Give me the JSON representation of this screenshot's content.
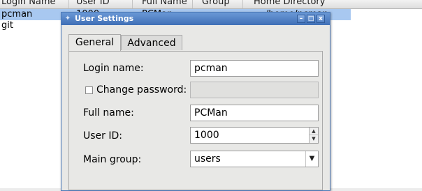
{
  "list": {
    "columns": [
      "Login Name",
      "User ID",
      "Full Name",
      "Group",
      "Home Directory"
    ],
    "rows": [
      {
        "login": "pcman",
        "uid": "1000",
        "fullname": "PCMan",
        "home_tail": "/home/pcman"
      },
      {
        "login": "git",
        "uid": "",
        "fullname": "",
        "home_tail": ""
      }
    ]
  },
  "dialog": {
    "title": "User Settings",
    "titlebar_buttons": {
      "minimize": "–",
      "maximize": "□",
      "close": "x"
    },
    "tabs": [
      {
        "label": "General",
        "active": true
      },
      {
        "label": "Advanced",
        "active": false
      }
    ],
    "fields": {
      "login_label": "Login name:",
      "login_value": "pcman",
      "change_password_label": "Change password:",
      "change_password_checked": false,
      "password_value": "",
      "fullname_label": "Full name:",
      "fullname_value": "PCMan",
      "uid_label": "User ID:",
      "uid_value": "1000",
      "group_label": "Main group:",
      "group_value": "users"
    }
  },
  "colors": {
    "titlebar": "#3f6fb6",
    "selection": "#a8c8f0",
    "dialog_bg": "#e8e8e6"
  }
}
